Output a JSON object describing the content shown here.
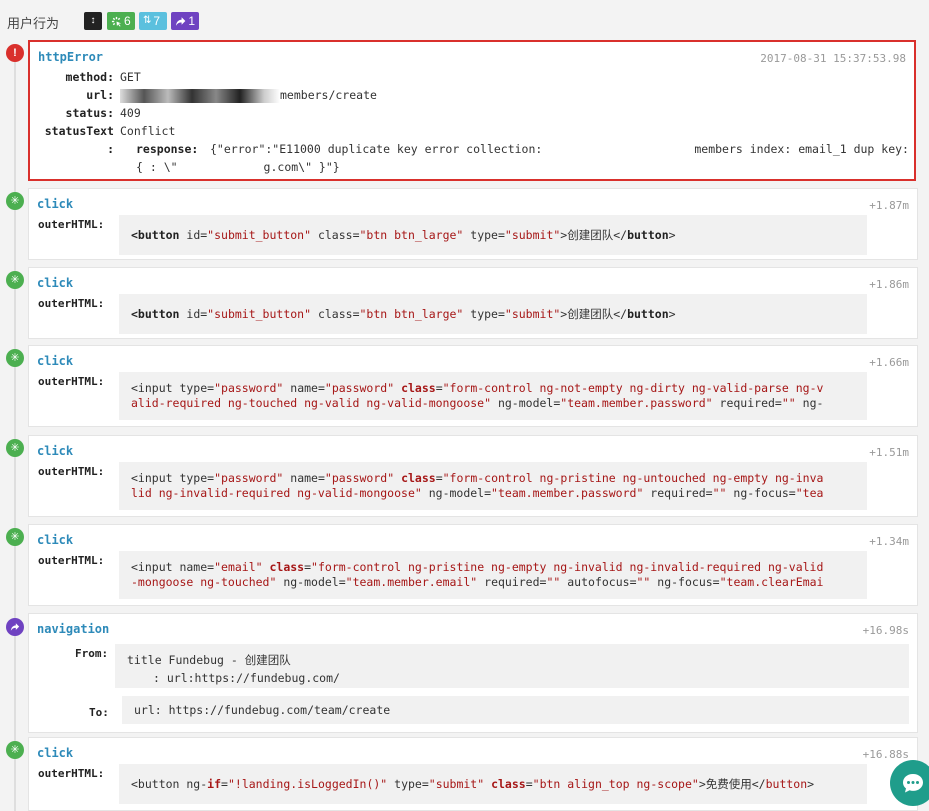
{
  "header": {
    "title": "用户行为",
    "badges": {
      "sort": "↕",
      "click_count": "6",
      "xhr_count": "7",
      "nav_count": "1"
    }
  },
  "events": {
    "error": {
      "type": "httpError",
      "time": "2017-08-31 15:37:53.98",
      "method_key": "method:",
      "method": "GET",
      "url_key": "url:",
      "url_tail": "members/create",
      "status_key": "status:",
      "status": "409",
      "statusText_key": "statusText",
      "statusText": "Conflict",
      "response_key": "response:",
      "response_line1a": "{\"error\":\"E11000 duplicate key error collection:",
      "response_line1b": "members index: email_1 dup key:",
      "response_line2a": "{ : \\\"",
      "response_line2b": "g.com\\\" }\"}"
    },
    "click1": {
      "type": "click",
      "time": "+1.87m",
      "label": "outerHTML:",
      "t_open": "<button",
      "a1": " id=",
      "s1": "\"submit_button\"",
      "a2": " class=",
      "s2": "\"btn btn_large\"",
      "a3": " type=",
      "s3": "\"submit\"",
      "text": ">创建团队</",
      "t_close": "button",
      "end": ">"
    },
    "click2": {
      "type": "click",
      "time": "+1.86m",
      "label": "outerHTML:",
      "t_open": "<button",
      "a1": " id=",
      "s1": "\"submit_button\"",
      "a2": " class=",
      "s2": "\"btn btn_large\"",
      "a3": " type=",
      "s3": "\"submit\"",
      "text": ">创建团队</",
      "t_close": "button",
      "end": ">"
    },
    "click3": {
      "type": "click",
      "time": "+1.66m",
      "label": "outerHTML:",
      "l1a": "<input type=",
      "l1s1": "\"password\"",
      "l1b": " name=",
      "l1s2": "\"password\"",
      "l1kw": " class",
      "l1c": "=",
      "l1s3": "\"form-control ng-not-empty ng-dirty ng-valid-parse ng-v",
      "l2s1": "alid-required ng-touched ng-valid ng-valid-mongoose\"",
      "l2b": " ng-model=",
      "l2s2": "\"team.member.password\"",
      "l2c": " required=",
      "l2s3": "\"\"",
      "l2d": " ng-"
    },
    "click4": {
      "type": "click",
      "time": "+1.51m",
      "label": "outerHTML:",
      "l1a": "<input type=",
      "l1s1": "\"password\"",
      "l1b": " name=",
      "l1s2": "\"password\"",
      "l1kw": " class",
      "l1c": "=",
      "l1s3": "\"form-control ng-pristine ng-untouched ng-empty ng-inva",
      "l2s1": "lid ng-invalid-required ng-valid-mongoose\"",
      "l2b": " ng-model=",
      "l2s2": "\"team.member.password\"",
      "l2c": " required=",
      "l2s3": "\"\"",
      "l2d": " ng-focus=",
      "l2s4": "\"tea"
    },
    "click5": {
      "type": "click",
      "time": "+1.34m",
      "label": "outerHTML:",
      "l1a": "<input name=",
      "l1s1": "\"email\"",
      "l1kw": " class",
      "l1c": "=",
      "l1s3": "\"form-control ng-pristine ng-empty ng-invalid ng-invalid-required ng-valid",
      "l2s1": "-mongoose ng-touched\"",
      "l2b": " ng-model=",
      "l2s2": "\"team.member.email\"",
      "l2c": " required=",
      "l2s3": "\"\"",
      "l2d": " autofocus=",
      "l2s4": "\"\"",
      "l2e": " ng-focus=",
      "l2s5": "\"team.clearEmai"
    },
    "navigation": {
      "type": "navigation",
      "time": "+16.98s",
      "from_label": "From:",
      "from_line1": "title Fundebug - 创建团队",
      "from_line2": ": url:https://fundebug.com/",
      "to_label": "To:",
      "to_value": "url: https://fundebug.com/team/create"
    },
    "click6": {
      "type": "click",
      "time": "+16.88s",
      "label": "outerHTML:",
      "a": "<button ng-",
      "kw": "if",
      "b": "=",
      "s1": "\"!landing.isLoggedIn()\"",
      "c": " type=",
      "s2": "\"submit\"",
      "kw2": " class",
      "d": "=",
      "s3": "\"btn align_top ng-scope\"",
      "text": ">免费使用</",
      "t_close": "button",
      "end": ">"
    }
  },
  "icons": {
    "error": "exclamation-icon",
    "click": "click-burst-icon",
    "navigation": "share-arrow-icon",
    "chat": "chat-bubble-icon"
  },
  "colors": {
    "error": "#d9302c",
    "click": "#4caf50",
    "xhr": "#5bc0de",
    "navigation": "#6f42c1",
    "event_type": "#2d8ab9",
    "string": "#a61717"
  }
}
